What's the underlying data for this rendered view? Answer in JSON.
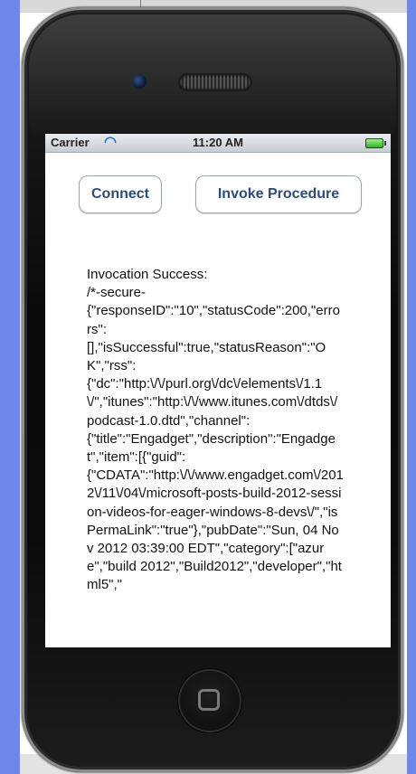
{
  "status_bar": {
    "carrier": "Carrier",
    "wifi_icon": "wifi-icon",
    "time": "11:20 AM",
    "battery_icon": "battery-icon"
  },
  "buttons": {
    "connect": "Connect",
    "invoke_procedure": "Invoke Procedure"
  },
  "output_text": "Invocation Success:\n/*-secure-\n{\"responseID\":\"10\",\"statusCode\":200,\"errors\":\n[],\"isSuccessful\":true,\"statusReason\":\"OK\",\"rss\":\n{\"dc\":\"http:\\/\\/purl.org\\/dc\\/elements\\/1.1\\/\",\"itunes\":\"http:\\/\\/www.itunes.com\\/dtds\\/podcast-1.0.dtd\",\"channel\":\n{\"title\":\"Engadget\",\"description\":\"Engadget\",\"item\":[{\"guid\":\n{\"CDATA\":\"http:\\/\\/www.engadget.com\\/2012\\/11\\/04\\/microsoft-posts-build-2012-session-videos-for-eager-windows-8-devs\\/\",\"isPermaLink\":\"true\"},\"pubDate\":\"Sun, 04 Nov 2012 03:39:00 EDT\",\"category\":[\"azure\",\"build 2012\",\"Build2012\",\"developer\",\"html5\",\"",
  "icons": {
    "camera": "camera-icon",
    "speaker": "speaker-grille-icon",
    "home": "home-button-icon"
  },
  "colors": {
    "frame": "#6f86ea",
    "button_text": "#2c4b82",
    "wifi": "#2f6fd0",
    "battery": "#2fb31f"
  }
}
